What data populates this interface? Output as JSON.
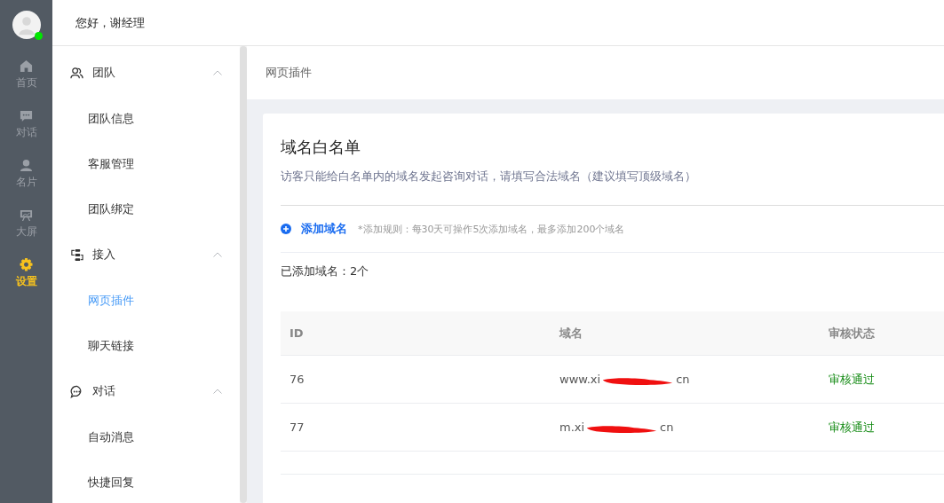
{
  "rail": {
    "online": true,
    "items": [
      {
        "label": "首页",
        "selected": false
      },
      {
        "label": "对话",
        "selected": false
      },
      {
        "label": "名片",
        "selected": false
      },
      {
        "label": "大屏",
        "selected": false
      },
      {
        "label": "设置",
        "selected": true
      }
    ]
  },
  "header": {
    "greeting": "您好，谢经理"
  },
  "menu": [
    {
      "label": "团队",
      "expanded": true,
      "children": [
        {
          "label": "团队信息",
          "selected": false
        },
        {
          "label": "客服管理",
          "selected": false
        },
        {
          "label": "团队绑定",
          "selected": false
        }
      ]
    },
    {
      "label": "接入",
      "expanded": true,
      "children": [
        {
          "label": "网页插件",
          "selected": true
        },
        {
          "label": "聊天链接",
          "selected": false
        }
      ]
    },
    {
      "label": "对话",
      "expanded": true,
      "children": [
        {
          "label": "自动消息",
          "selected": false
        },
        {
          "label": "快捷回复",
          "selected": false
        }
      ]
    }
  ],
  "breadcrumb": "网页插件",
  "card": {
    "title": "域名白名单",
    "description": "访客只能给白名单内的域名发起咨询对话，请填写合法域名（建议填写顶级域名）",
    "add_button": "添加域名",
    "rule": "*添加规则：每30天可操作5次添加域名，最多添加200个域名",
    "count": "已添加域名：2个",
    "table": {
      "columns": [
        "ID",
        "域名",
        "审核状态"
      ],
      "rows": [
        {
          "id": "76",
          "domain": "www.xi",
          "domain_tail": "cn",
          "status": "审核通过",
          "redacted": true
        },
        {
          "id": "77",
          "domain": "m.xi",
          "domain_tail": "cn",
          "status": "审核通过",
          "redacted": true
        }
      ]
    }
  }
}
